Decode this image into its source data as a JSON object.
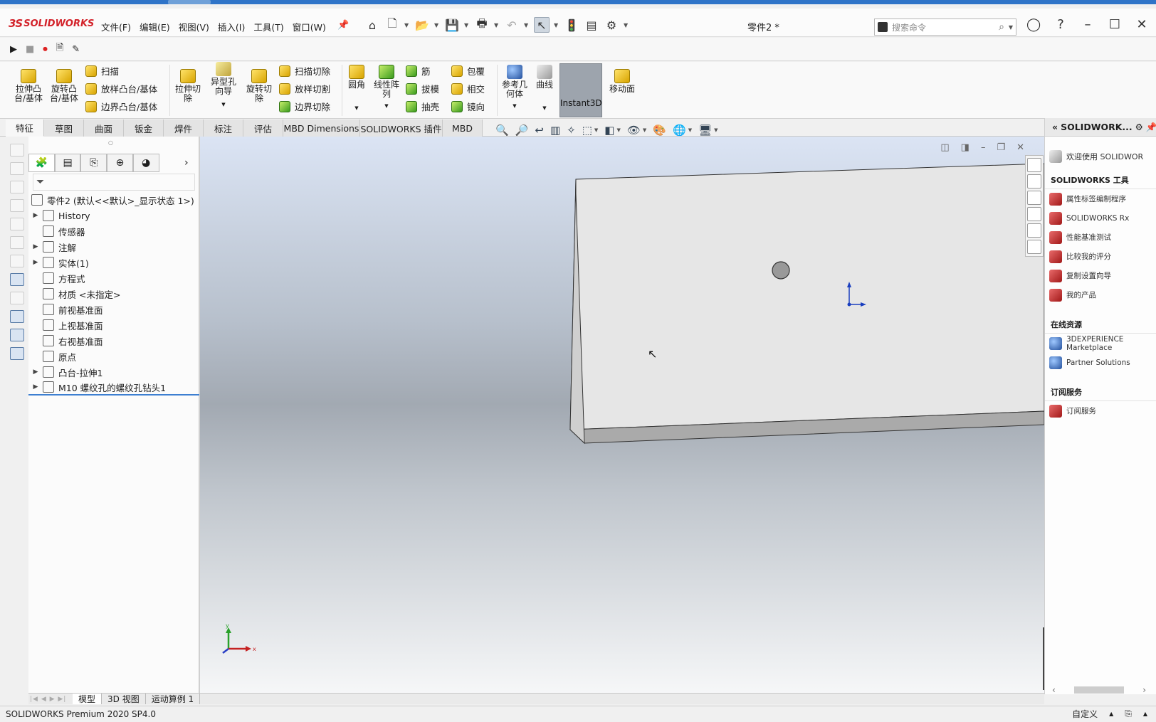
{
  "app": {
    "brand_ds": "3S",
    "brand_name": "SOLIDWORKS",
    "doc_title": "零件2 *"
  },
  "menu": [
    "文件(F)",
    "编辑(E)",
    "视图(V)",
    "插入(I)",
    "工具(T)",
    "窗口(W)"
  ],
  "search": {
    "placeholder": "搜索命令"
  },
  "ribbon": {
    "extrude_boss": "拉伸凸\n台/基体",
    "revolve_boss": "旋转凸\n台/基体",
    "sweep": "扫描",
    "loft_boss": "放样凸台/基体",
    "boundary_boss": "边界凸台/基体",
    "extrude_cut": "拉伸切\n除",
    "hole_wizard": "异型孔\n向导",
    "revolve_cut": "旋转切\n除",
    "swept_cut": "扫描切除",
    "lofted_cut": "放样切割",
    "boundary_cut": "边界切除",
    "fillet": "圆角",
    "linear_pattern": "线性阵\n列",
    "rib": "筋",
    "draft": "拔模",
    "shell": "抽壳",
    "wrap": "包覆",
    "intersect": "相交",
    "mirror": "镜向",
    "ref_geometry": "参考几\n何体",
    "curves": "曲线",
    "instant3d": "Instant3D",
    "move_face": "移动面"
  },
  "tabs": [
    "特征",
    "草图",
    "曲面",
    "钣金",
    "焊件",
    "标注",
    "评估",
    "MBD Dimensions",
    "SOLIDWORKS 插件",
    "MBD"
  ],
  "tree": {
    "root": "零件2  (默认<<默认>_显示状态 1>)",
    "items": [
      {
        "label": "History",
        "expand": true,
        "icon": "history-icon"
      },
      {
        "label": "传感器",
        "expand": false,
        "icon": "sensor-icon"
      },
      {
        "label": "注解",
        "expand": true,
        "icon": "annotation-icon"
      },
      {
        "label": "实体(1)",
        "expand": true,
        "icon": "solid-bodies-icon"
      },
      {
        "label": "方程式",
        "expand": false,
        "icon": "equation-icon"
      },
      {
        "label": "材质 <未指定>",
        "expand": false,
        "icon": "material-icon"
      },
      {
        "label": "前视基准面",
        "expand": false,
        "icon": "plane-icon"
      },
      {
        "label": "上视基准面",
        "expand": false,
        "icon": "plane-icon"
      },
      {
        "label": "右视基准面",
        "expand": false,
        "icon": "plane-icon"
      },
      {
        "label": "原点",
        "expand": false,
        "icon": "origin-icon"
      },
      {
        "label": "凸台-拉伸1",
        "expand": true,
        "icon": "boss-extrude-icon"
      },
      {
        "label": "M10 螺纹孔的螺纹孔钻头1",
        "expand": true,
        "icon": "hole-icon"
      }
    ]
  },
  "taskpane": {
    "title": "SOLIDWORK...",
    "welcome": "欢迎使用 SOLIDWOR",
    "tools_header": "SOLIDWORKS 工具",
    "tools": [
      "属性标签编制程序",
      "SOLIDWORKS Rx",
      "性能基准测试",
      "比较我的评分",
      "复制设置向导",
      "我的产品"
    ],
    "online_header": "在线资源",
    "online": [
      "3DEXPERIENCE Marketplace",
      "Partner Solutions"
    ],
    "sub_header": "订阅服务",
    "sub": [
      "订阅服务"
    ]
  },
  "triad": {
    "x": "x",
    "y": "y"
  },
  "bottom_tabs": [
    "模型",
    "3D 视图",
    "运动算例 1"
  ],
  "status": {
    "product": "SOLIDWORKS Premium 2020 SP4.0",
    "units": "自定义"
  }
}
